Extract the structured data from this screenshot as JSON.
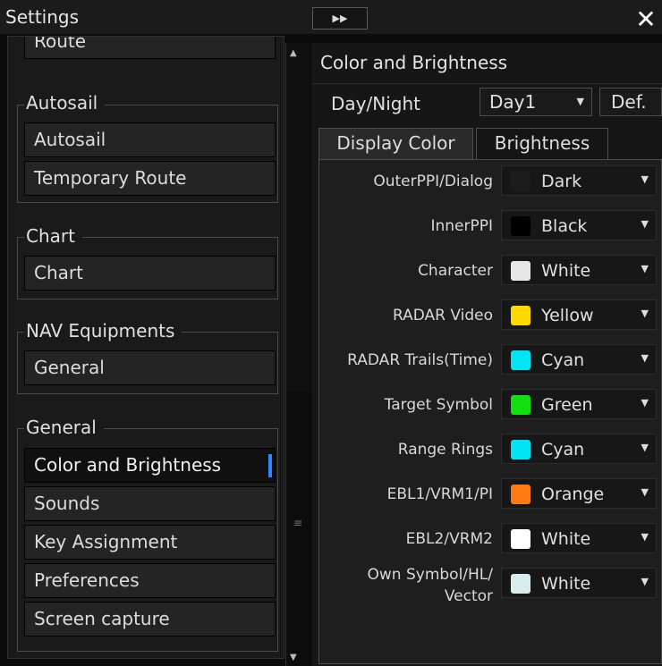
{
  "window": {
    "title": "Settings",
    "close_icon": "close-icon",
    "expand_icon": "double-chevron-right-icon"
  },
  "sidebar": {
    "route_item": "Route",
    "groups": [
      {
        "title": "Autosail",
        "items": [
          "Autosail",
          "Temporary Route"
        ]
      },
      {
        "title": "Chart",
        "items": [
          "Chart"
        ]
      },
      {
        "title": "NAV Equipments",
        "items": [
          "General"
        ]
      },
      {
        "title": "General",
        "items": [
          "Color and Brightness",
          "Sounds",
          "Key Assignment",
          "Preferences",
          "Screen capture"
        ]
      }
    ],
    "selected": "Color and Brightness"
  },
  "panel": {
    "title": "Color and Brightness",
    "day_night_label": "Day/Night",
    "day_night_value": "Day1",
    "default_button": "Def.",
    "tabs": [
      "Display Color",
      "Brightness"
    ],
    "active_tab": "Display Color",
    "rows": [
      {
        "label": "OuterPPI/Dialog",
        "value": "Dark",
        "color": "#1c1c1c"
      },
      {
        "label": "InnerPPI",
        "value": "Black",
        "color": "#000000"
      },
      {
        "label": "Character",
        "value": "White",
        "color": "#e6e6e6"
      },
      {
        "label": "RADAR Video",
        "value": "Yellow",
        "color": "#ffd800"
      },
      {
        "label": "RADAR Trails(Time)",
        "value": "Cyan",
        "color": "#00e5f5"
      },
      {
        "label": "Target Symbol",
        "value": "Green",
        "color": "#10e010"
      },
      {
        "label": "Range Rings",
        "value": "Cyan",
        "color": "#00e5f5"
      },
      {
        "label": "EBL1/VRM1/PI",
        "value": "Orange",
        "color": "#ff7a10"
      },
      {
        "label": "EBL2/VRM2",
        "value": "White",
        "color": "#ffffff"
      },
      {
        "label": "Own Symbol/HL/\nVector",
        "value": "White",
        "color": "#d8ecec"
      }
    ]
  }
}
